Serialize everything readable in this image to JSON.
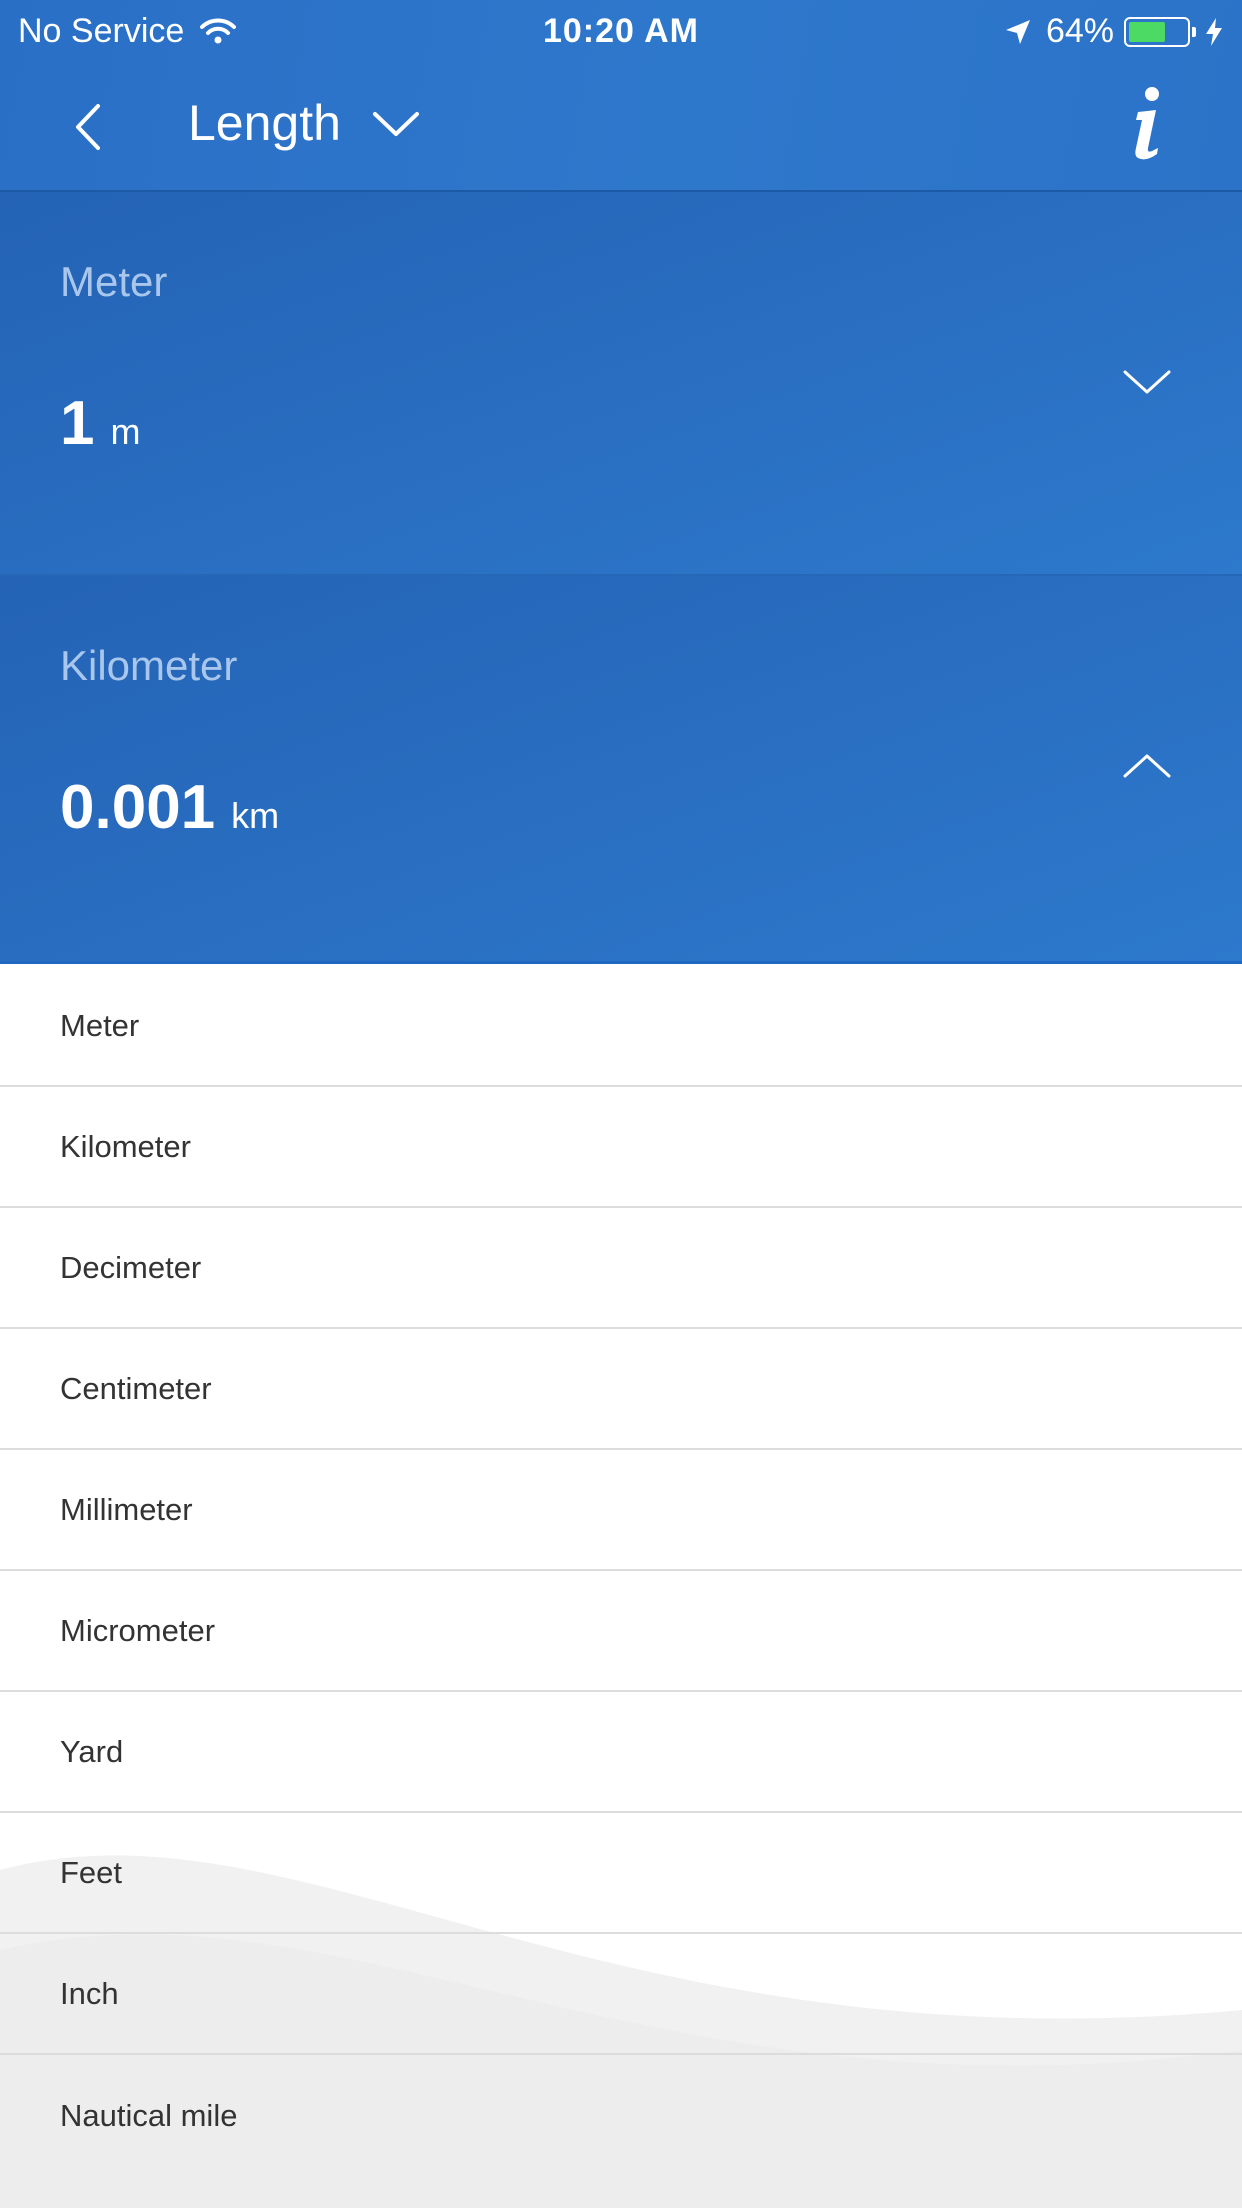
{
  "status_bar": {
    "carrier": "No Service",
    "time": "10:20 AM",
    "battery_percent": "64%",
    "battery_level": 0.64,
    "icons": [
      "wifi-icon",
      "location-arrow-icon",
      "battery-icon",
      "charging-bolt-icon"
    ]
  },
  "nav": {
    "title": "Length",
    "icons": [
      "chevron-left-icon",
      "chevron-down-icon",
      "info-icon"
    ]
  },
  "from_unit": {
    "name": "Meter",
    "value": "1",
    "abbr": "m",
    "chevron": "chevron-down-icon"
  },
  "to_unit": {
    "name": "Kilometer",
    "value": "0.001",
    "abbr": "km",
    "chevron": "chevron-up-icon"
  },
  "unit_list": [
    "Meter",
    "Kilometer",
    "Decimeter",
    "Centimeter",
    "Millimeter",
    "Micrometer",
    "Yard",
    "Feet",
    "Inch",
    "Nautical mile"
  ],
  "colors": {
    "header_blue": "#2a6fc6",
    "panel_blue": "#2463b5",
    "label_light_blue": "#a9c6ec",
    "battery_green": "#4cd964"
  }
}
